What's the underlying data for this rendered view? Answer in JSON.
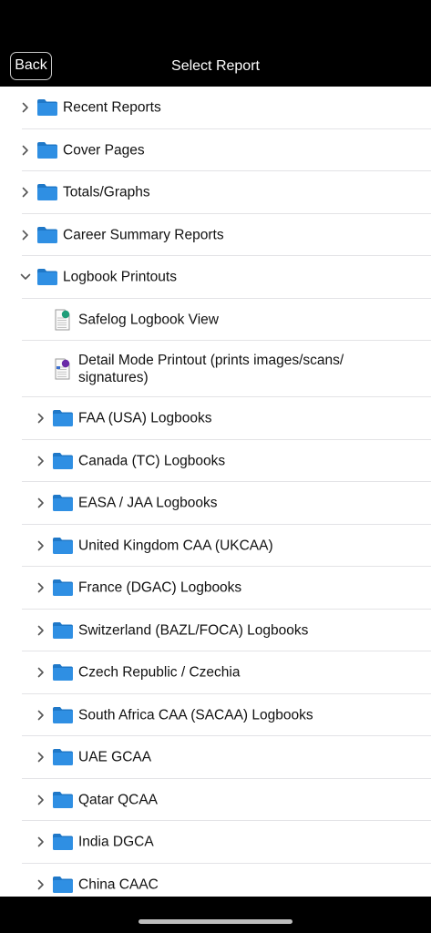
{
  "header": {
    "back_label": "Back",
    "title": "Select Report"
  },
  "colors": {
    "folder": "#2f8fe3",
    "background": "#ffffff",
    "bar": "#000000",
    "doc_badge_green": "#1f9e7a",
    "doc_badge_purple": "#6a2aa8"
  },
  "items": [
    {
      "label": "Recent Reports",
      "type": "folder",
      "level": 0,
      "expanded": false
    },
    {
      "label": "Cover Pages",
      "type": "folder",
      "level": 0,
      "expanded": false
    },
    {
      "label": "Totals/Graphs",
      "type": "folder",
      "level": 0,
      "expanded": false
    },
    {
      "label": "Career Summary Reports",
      "type": "folder",
      "level": 0,
      "expanded": false
    },
    {
      "label": "Logbook Printouts",
      "type": "folder",
      "level": 0,
      "expanded": true
    },
    {
      "label": "Safelog Logbook View",
      "type": "doc",
      "level": 1,
      "badge": "green"
    },
    {
      "label": "Detail Mode Printout (prints images/scans/ signatures)",
      "type": "doc",
      "level": 1,
      "badge": "purple"
    },
    {
      "label": "FAA (USA) Logbooks",
      "type": "folder",
      "level": 1,
      "expanded": false
    },
    {
      "label": "Canada (TC) Logbooks",
      "type": "folder",
      "level": 1,
      "expanded": false
    },
    {
      "label": "EASA / JAA Logbooks",
      "type": "folder",
      "level": 1,
      "expanded": false
    },
    {
      "label": "United Kingdom CAA (UKCAA)",
      "type": "folder",
      "level": 1,
      "expanded": false
    },
    {
      "label": "France (DGAC) Logbooks",
      "type": "folder",
      "level": 1,
      "expanded": false
    },
    {
      "label": "Switzerland (BAZL/FOCA) Logbooks",
      "type": "folder",
      "level": 1,
      "expanded": false
    },
    {
      "label": "Czech Republic / Czechia",
      "type": "folder",
      "level": 1,
      "expanded": false
    },
    {
      "label": "South Africa CAA (SACAA) Logbooks",
      "type": "folder",
      "level": 1,
      "expanded": false
    },
    {
      "label": "UAE GCAA",
      "type": "folder",
      "level": 1,
      "expanded": false
    },
    {
      "label": "Qatar QCAA",
      "type": "folder",
      "level": 1,
      "expanded": false
    },
    {
      "label": "India DGCA",
      "type": "folder",
      "level": 1,
      "expanded": false
    },
    {
      "label": "China CAAC",
      "type": "folder",
      "level": 1,
      "expanded": false
    }
  ]
}
